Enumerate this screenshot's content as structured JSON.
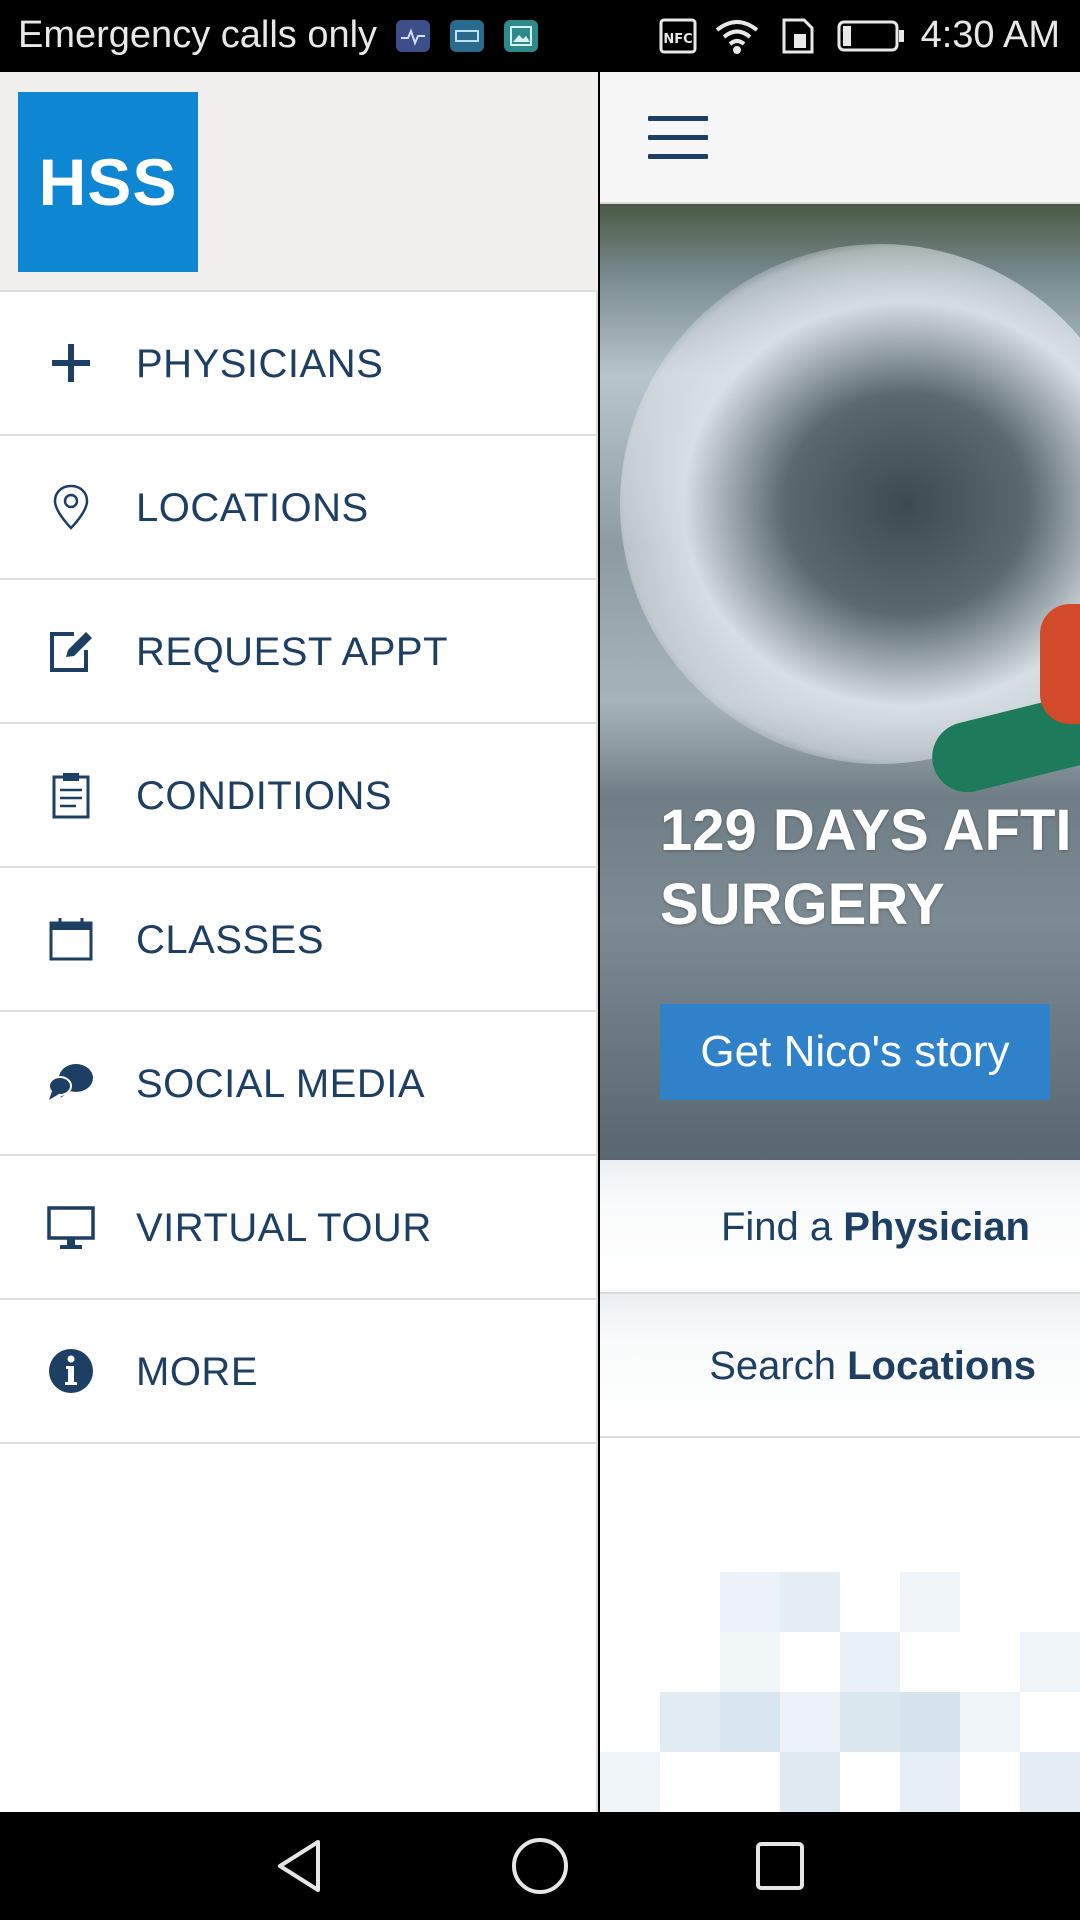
{
  "status_bar": {
    "carrier": "Emergency calls only",
    "time": "4:30 AM",
    "icons": [
      "health-app-icon",
      "emui-app-icon",
      "gallery-app-icon",
      "nfc-icon",
      "wifi-icon",
      "sim-icon",
      "battery-icon"
    ]
  },
  "drawer": {
    "logo_text": "HSS",
    "brand_color": "#0f86d2",
    "items": [
      {
        "label": "PHYSICIANS",
        "icon": "plus-icon"
      },
      {
        "label": "LOCATIONS",
        "icon": "map-pin-icon"
      },
      {
        "label": "REQUEST APPT",
        "icon": "edit-icon"
      },
      {
        "label": "CONDITIONS",
        "icon": "clipboard-icon"
      },
      {
        "label": "CLASSES",
        "icon": "calendar-icon"
      },
      {
        "label": "SOCIAL MEDIA",
        "icon": "chat-bubbles-icon"
      },
      {
        "label": "VIRTUAL TOUR",
        "icon": "monitor-icon"
      },
      {
        "label": "MORE",
        "icon": "info-icon"
      }
    ]
  },
  "main": {
    "hero": {
      "headline": "129 DAYS AFTI\nSURGERY",
      "cta_label": "Get Nico's story",
      "cta_color": "#2f82c9"
    },
    "quick_links": [
      {
        "prefix": "Find a ",
        "emphasis": "Physician"
      },
      {
        "prefix": "Search ",
        "emphasis": "Locations"
      }
    ]
  },
  "colors": {
    "text_primary": "#1d3f63"
  }
}
